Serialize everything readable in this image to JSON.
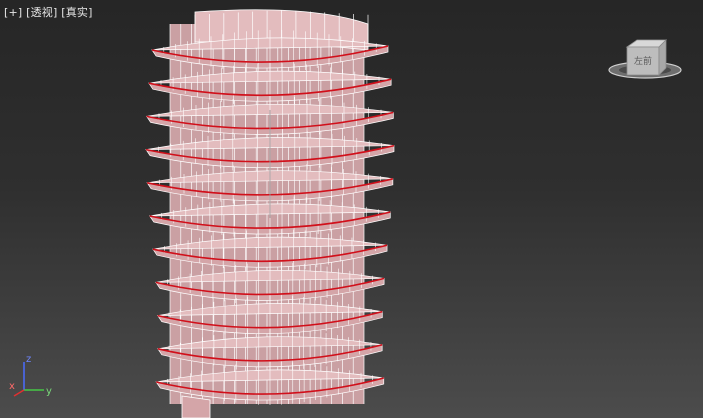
{
  "viewport": {
    "menus": {
      "plus": "[+]",
      "view": "[透视]",
      "shading": "[真实]"
    },
    "axis_labels": {
      "x": "x",
      "y": "y",
      "z": "z"
    },
    "viewcube": {
      "face_label": "左前"
    }
  },
  "colors": {
    "mesh_face": "#d4a5a8",
    "mesh_face_top": "#e3bcbe",
    "mesh_edge": "#ffffff",
    "selected_edge": "#d10f1a",
    "axis_x": "#e03030",
    "axis_y": "#46c846",
    "axis_z": "#4a6cff"
  }
}
